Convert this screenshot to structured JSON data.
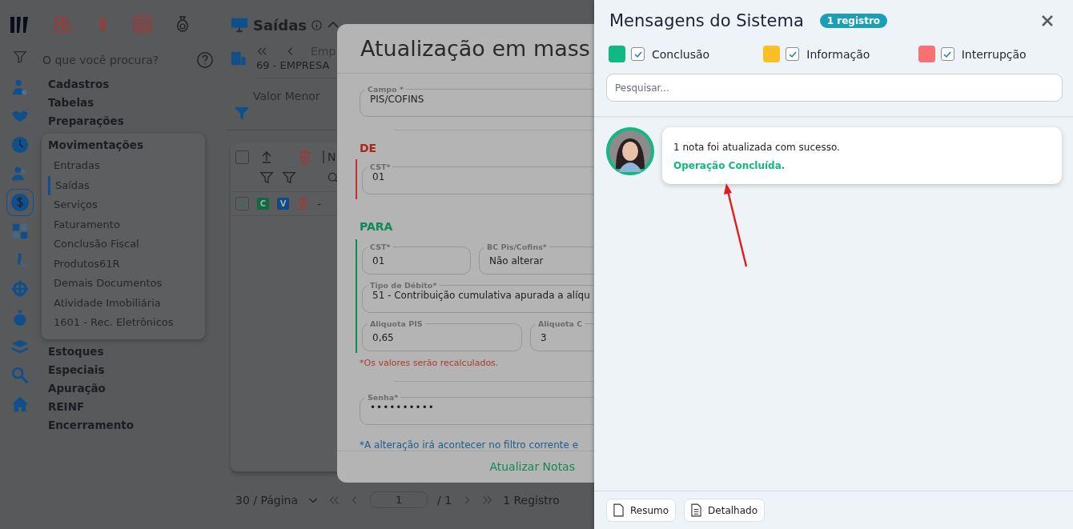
{
  "search": {
    "placeholder": "O que você procura?"
  },
  "menu": [
    {
      "label": "Cadastros",
      "expanded": false
    },
    {
      "label": "Tabelas",
      "expanded": false
    },
    {
      "label": "Preparações",
      "expanded": false
    },
    {
      "label": "Movimentações",
      "expanded": true,
      "children": [
        {
          "label": "Entradas",
          "selected": false
        },
        {
          "label": "Saídas",
          "selected": true
        },
        {
          "label": "Serviços",
          "selected": false
        },
        {
          "label": "Faturamento",
          "selected": false
        },
        {
          "label": "Conclusão Fiscal",
          "selected": false
        },
        {
          "label": "Produtos61R",
          "selected": false
        },
        {
          "label": "Demais Documentos",
          "selected": false
        },
        {
          "label": "Atividade Imobiliária",
          "selected": false
        },
        {
          "label": "1601 - Rec. Eletrônicos",
          "selected": false
        }
      ]
    },
    {
      "label": "Estoques",
      "expanded": false
    },
    {
      "label": "Especiais",
      "expanded": false
    },
    {
      "label": "Apuração",
      "expanded": false
    },
    {
      "label": "REINF",
      "expanded": false
    },
    {
      "label": "Encerramento",
      "expanded": false
    }
  ],
  "page": {
    "title": "Saídas",
    "company_nav": "Emp",
    "company": "69 - EMPRESA",
    "filter_label": "Valor Menor"
  },
  "table": {
    "header_checked": false,
    "header_cell": "N",
    "rows": [
      {
        "checked": true,
        "tag_c": "C",
        "tag_v": "V",
        "text": "-"
      }
    ]
  },
  "pagination": {
    "page_size": "30 / Página",
    "page": "1",
    "total_pages": "/ 1",
    "count": "1 Registro"
  },
  "modal": {
    "title": "Atualização em mass",
    "campo": {
      "label": "Campo *",
      "value": "PIS/COFINS"
    },
    "de": {
      "heading": "DE",
      "cst": {
        "label": "CST*",
        "value": "01"
      }
    },
    "para": {
      "heading": "PARA",
      "cst": {
        "label": "CST*",
        "value": "01"
      },
      "bc": {
        "label": "BC Pis/Cofins*",
        "value": "Não alterar"
      },
      "tipo": {
        "label": "Tipo de Débito*",
        "value": "51 - Contribuição cumulativa apurada a alíqu"
      },
      "pis": {
        "label": "Aliquota PIS",
        "value": "0,65"
      },
      "cofins": {
        "label": "Aliquota C",
        "value": "3"
      }
    },
    "recalc_note": "*Os valores serão recalculados.",
    "senha": {
      "label": "Senha*",
      "value": "••••••••••"
    },
    "filter_note": "*A alteração irá acontecer no filtro corrente e",
    "submit": "Atualizar Notas"
  },
  "drawer": {
    "title": "Mensagens do Sistema",
    "badge": "1 registro",
    "filters": [
      {
        "label": "Conclusão",
        "color": "#10b981",
        "checked": true
      },
      {
        "label": "Informação",
        "color": "#fbbf24",
        "checked": true
      },
      {
        "label": "Interrupção",
        "color": "#f87171",
        "checked": true
      }
    ],
    "search": {
      "placeholder": "Pesquisar..."
    },
    "messages": [
      {
        "text": "1 nota foi atualizada com sucesso.",
        "status": "Operação Concluída."
      }
    ],
    "buttons": [
      {
        "label": "Resumo"
      },
      {
        "label": "Detalhado"
      }
    ]
  }
}
